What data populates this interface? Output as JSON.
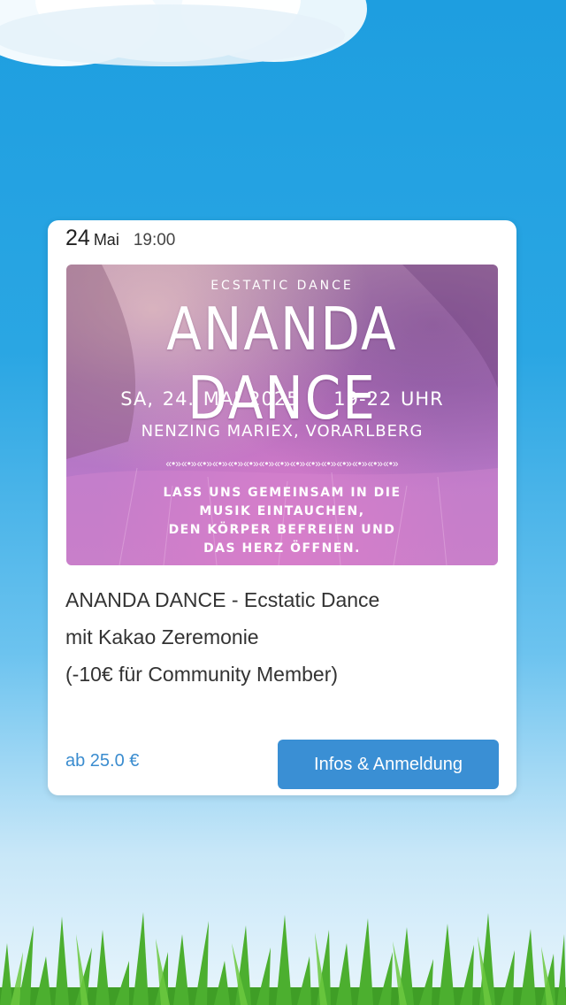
{
  "event": {
    "date_day": "24",
    "date_month": "Mai",
    "time": "19:00",
    "banner": {
      "subtitle": "ECSTATIC DANCE",
      "title": "ANANDA DANCE",
      "date_line": "SA, 24. MAI 2025    19-22 UHR",
      "location_line": "NENZING MARIEX, VORARLBERG",
      "divider": "«•»«•»«•»«•»«•»«•»«•»«•»«•»«•»«•»«•»«•»«•»«•»",
      "message_line1": "LASS UNS GEMEINSAM IN DIE",
      "message_line2": "MUSIK EINTAUCHEN,",
      "message_line3": "DEN KÖRPER BEFREIEN UND",
      "message_line4": "DAS HERZ ÖFFNEN."
    },
    "description_line1": "ANANDA DANCE - Ecstatic Dance",
    "description_line2": "mit Kakao Zeremonie",
    "description_line3": "(-10€ für Community Member)",
    "price": "ab 25.0 €",
    "button_label": "Infos & Anmeldung"
  },
  "colors": {
    "sky": "#1e9ee0",
    "accent": "#3a8fd4",
    "price": "#3a8ccf",
    "banner_purple": "#a66fb8",
    "grass": "#4caf2f"
  },
  "icons": {
    "cloud": "cloud-icon",
    "grass": "grass-decoration"
  }
}
